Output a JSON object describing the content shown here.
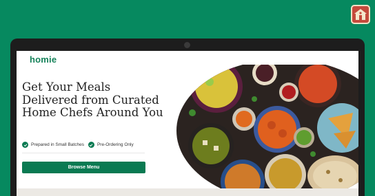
{
  "brand": {
    "logo_text": "homie",
    "badge_icon": "home-icon",
    "accent": "#0a7a52",
    "page_bg": "#06895f"
  },
  "hero": {
    "headline": "Get Your Meals Delivered from Curated Home Chefs Around You",
    "features": [
      {
        "label": "Prepared in Small Batches",
        "icon": "check-circle-icon"
      },
      {
        "label": "Pre-Ordering Only",
        "icon": "check-circle-icon"
      }
    ],
    "cta_label": "Browse Menu",
    "image_subject": "food-platter-image"
  }
}
